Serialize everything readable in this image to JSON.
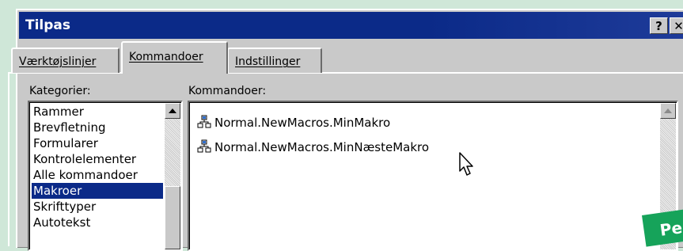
{
  "dialog": {
    "title": "Tilpas",
    "help_label": "?",
    "close_label": "✕"
  },
  "tabs": [
    {
      "label": "Værktøjslinjer",
      "active": false
    },
    {
      "label": "Kommandoer",
      "active": true
    },
    {
      "label": "Indstillinger",
      "active": false
    }
  ],
  "categories": {
    "label": "Kategorier:",
    "items": [
      "Rammer",
      "Brevfletning",
      "Formularer",
      "Kontrolelementer",
      "Alle kommandoer",
      "Makroer",
      "Skrifttyper",
      "Autotekst"
    ],
    "selected": "Makroer"
  },
  "commands": {
    "label": "Kommandoer:",
    "items": [
      {
        "label": "Normal.NewMacros.MinMakro",
        "icon": "macro-icon"
      },
      {
        "label": "Normal.NewMacros.MinNæsteMakro",
        "icon": "macro-icon"
      }
    ]
  },
  "overlay": {
    "badge_text": "Pe",
    "badge_color": "#16a35a"
  },
  "colors": {
    "title_bar": "#0b2a88",
    "selection": "#0b2a88",
    "dialog_face": "#c9c9c9",
    "background": "#cfe7d8"
  }
}
